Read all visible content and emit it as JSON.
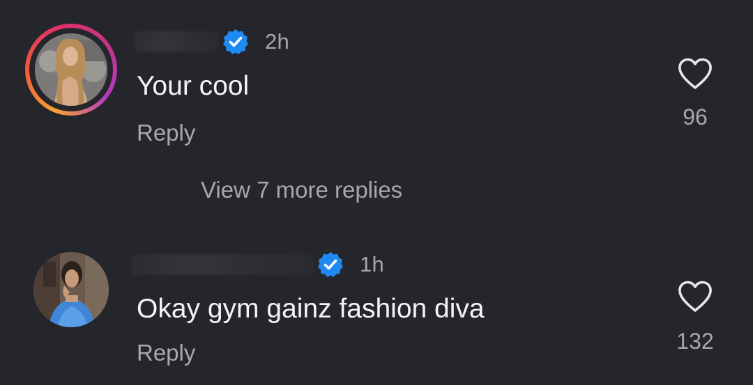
{
  "colors": {
    "background": "#25262b",
    "primary_text": "#f4f4f6",
    "secondary_text": "#a7a8ae",
    "verified_badge": "#1f8af1",
    "story_ring_gradient": [
      "#f9a234",
      "#e1306c",
      "#b23bc2"
    ]
  },
  "comments": [
    {
      "username": "",
      "verified": true,
      "timestamp": "2h",
      "text": "Your cool",
      "reply_label": "Reply",
      "like_count": "96",
      "has_story_ring": true
    },
    {
      "username": "",
      "verified": true,
      "timestamp": "1h",
      "text": "Okay gym gainz fashion diva",
      "reply_label": "Reply",
      "like_count": "132",
      "has_story_ring": false
    }
  ],
  "view_more_replies_label": "View 7 more replies",
  "icons": {
    "verified": "verified-badge-icon",
    "like": "heart-outline-icon"
  }
}
